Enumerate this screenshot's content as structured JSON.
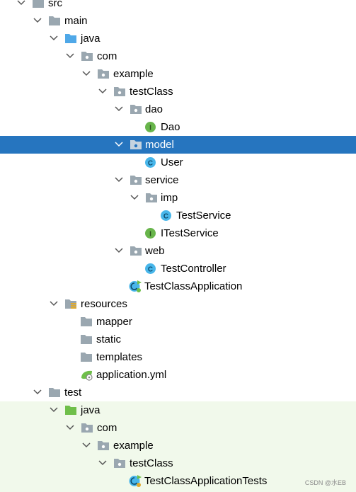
{
  "tree": {
    "src": {
      "label": "src"
    },
    "main": {
      "label": "main"
    },
    "main_java": {
      "label": "java"
    },
    "main_com": {
      "label": "com"
    },
    "main_example": {
      "label": "example"
    },
    "main_testClass": {
      "label": "testClass"
    },
    "dao": {
      "label": "dao"
    },
    "dao_Dao": {
      "label": "Dao",
      "icon": "interface-icon",
      "badge": "I"
    },
    "model": {
      "label": "model"
    },
    "model_User": {
      "label": "User",
      "icon": "class-icon",
      "badge": "C"
    },
    "service": {
      "label": "service"
    },
    "imp": {
      "label": "imp"
    },
    "imp_TestService": {
      "label": "TestService",
      "icon": "class-icon",
      "badge": "C"
    },
    "service_ITestService": {
      "label": "ITestService",
      "icon": "interface-icon",
      "badge": "I"
    },
    "web": {
      "label": "web"
    },
    "web_TestController": {
      "label": "TestController",
      "icon": "class-icon",
      "badge": "C"
    },
    "TestClassApplication": {
      "label": "TestClassApplication",
      "icon": "spring-boot-app-icon"
    },
    "resources": {
      "label": "resources"
    },
    "mapper": {
      "label": "mapper"
    },
    "static": {
      "label": "static"
    },
    "templates": {
      "label": "templates"
    },
    "application_yml": {
      "label": "application.yml",
      "icon": "yaml-config-icon"
    },
    "test": {
      "label": "test"
    },
    "test_java": {
      "label": "java"
    },
    "test_com": {
      "label": "com"
    },
    "test_example": {
      "label": "example"
    },
    "test_testClass": {
      "label": "testClass"
    },
    "TestClassApplicationTests": {
      "label": "TestClassApplicationTests",
      "icon": "spring-boot-test-icon"
    }
  },
  "watermark": "CSDN @水EB",
  "colors": {
    "selection": "#2675bf",
    "test_background": "#f1f9eb",
    "folder_gray": "#9aa7b0",
    "java_source_blue": "#4fa8e8",
    "java_test_green": "#6fbf4a",
    "class_icon": "#48b6ea",
    "interface_icon": "#68b54b"
  }
}
